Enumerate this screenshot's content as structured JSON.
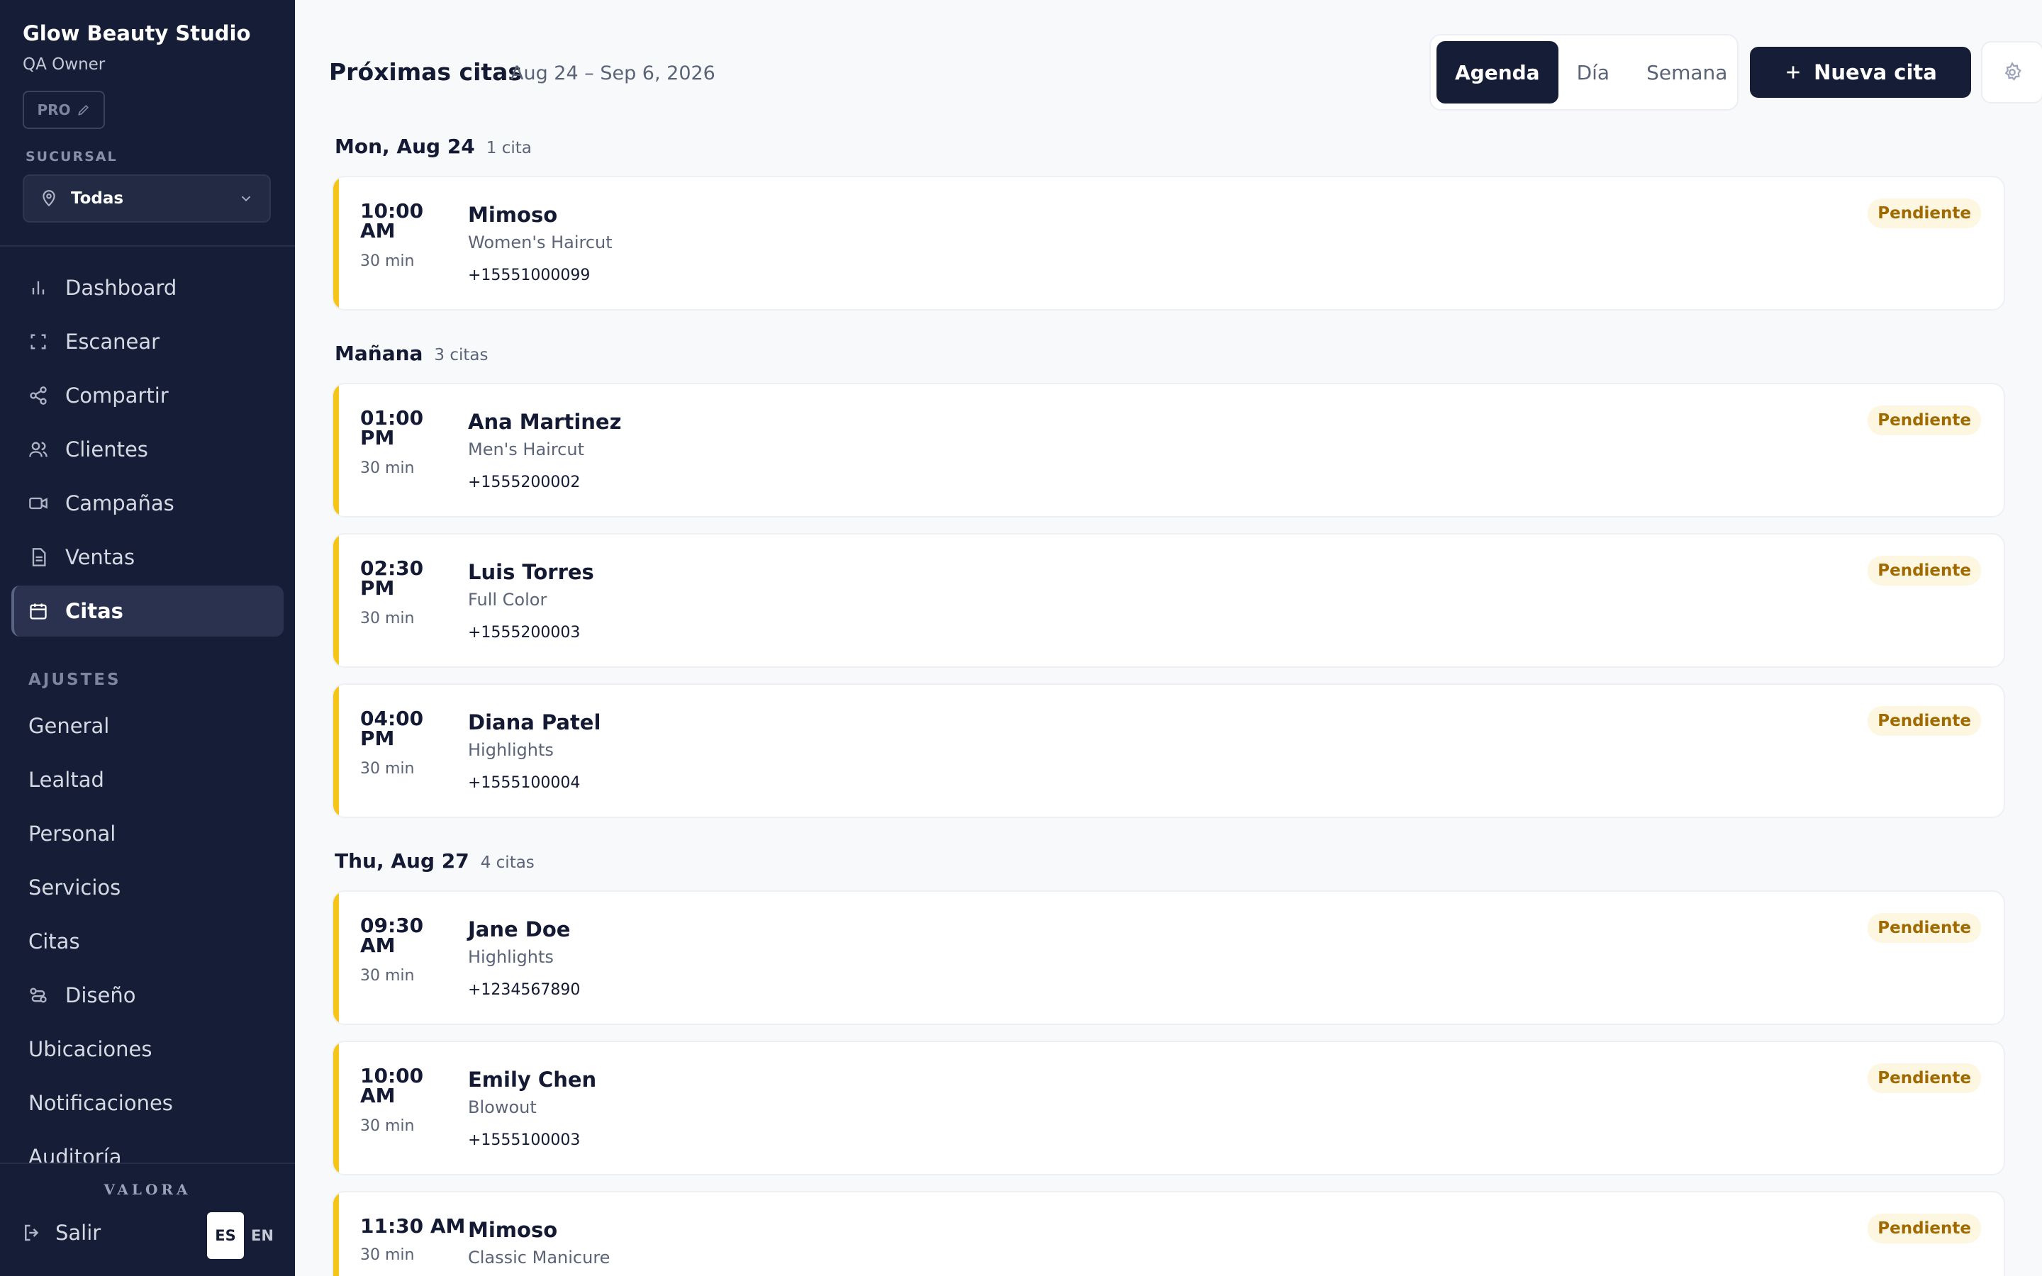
{
  "sidebar": {
    "brand_title": "Glow Beauty Studio",
    "brand_sub": "QA Owner",
    "plan_badge": "PRO",
    "branch_label": "SUCURSAL",
    "branch_value": "Todas",
    "nav": [
      "Dashboard",
      "Escanear",
      "Compartir",
      "Clientes",
      "Campañas",
      "Ventas",
      "Citas"
    ],
    "settings_heading": "AJUSTES",
    "settings": [
      "General",
      "Lealtad",
      "Personal",
      "Servicios",
      "Citas",
      "Diseño",
      "Ubicaciones",
      "Notificaciones",
      "Auditoría"
    ],
    "footer_brand": "VALORA",
    "logout": "Salir",
    "lang_es": "ES",
    "lang_en": "EN"
  },
  "header": {
    "title": "Próximas citas",
    "range": "Aug 24 – Sep 6, 2026",
    "tabs": [
      "Agenda",
      "Día",
      "Semana"
    ],
    "new_button": "Nueva cita"
  },
  "groups": [
    {
      "day": "Mon, Aug 24",
      "count": "1 cita"
    },
    {
      "day": "Mañana",
      "count": "3 citas"
    },
    {
      "day": "Thu, Aug 27",
      "count": "4 citas"
    }
  ],
  "appointments": [
    {
      "time": "10:00 AM",
      "duration": "30 min",
      "client": "Mimoso",
      "service": "Women's Haircut",
      "phone": "+15551000099",
      "status": "Pendiente"
    },
    {
      "time": "01:00 PM",
      "duration": "30 min",
      "client": "Ana Martinez",
      "service": "Men's Haircut",
      "phone": "+1555200002",
      "status": "Pendiente"
    },
    {
      "time": "02:30 PM",
      "duration": "30 min",
      "client": "Luis Torres",
      "service": "Full Color",
      "phone": "+1555200003",
      "status": "Pendiente"
    },
    {
      "time": "04:00 PM",
      "duration": "30 min",
      "client": "Diana Patel",
      "service": "Highlights",
      "phone": "+1555100004",
      "status": "Pendiente"
    },
    {
      "time": "09:30 AM",
      "duration": "30 min",
      "client": "Jane Doe",
      "service": "Highlights",
      "phone": "+1234567890",
      "status": "Pendiente"
    },
    {
      "time": "10:00 AM",
      "duration": "30 min",
      "client": "Emily Chen",
      "service": "Blowout",
      "phone": "+1555100003",
      "status": "Pendiente"
    },
    {
      "time": "11:30 AM",
      "duration": "30 min",
      "client": "Mimoso",
      "service": "Classic Manicure",
      "status": "Pendiente"
    }
  ]
}
